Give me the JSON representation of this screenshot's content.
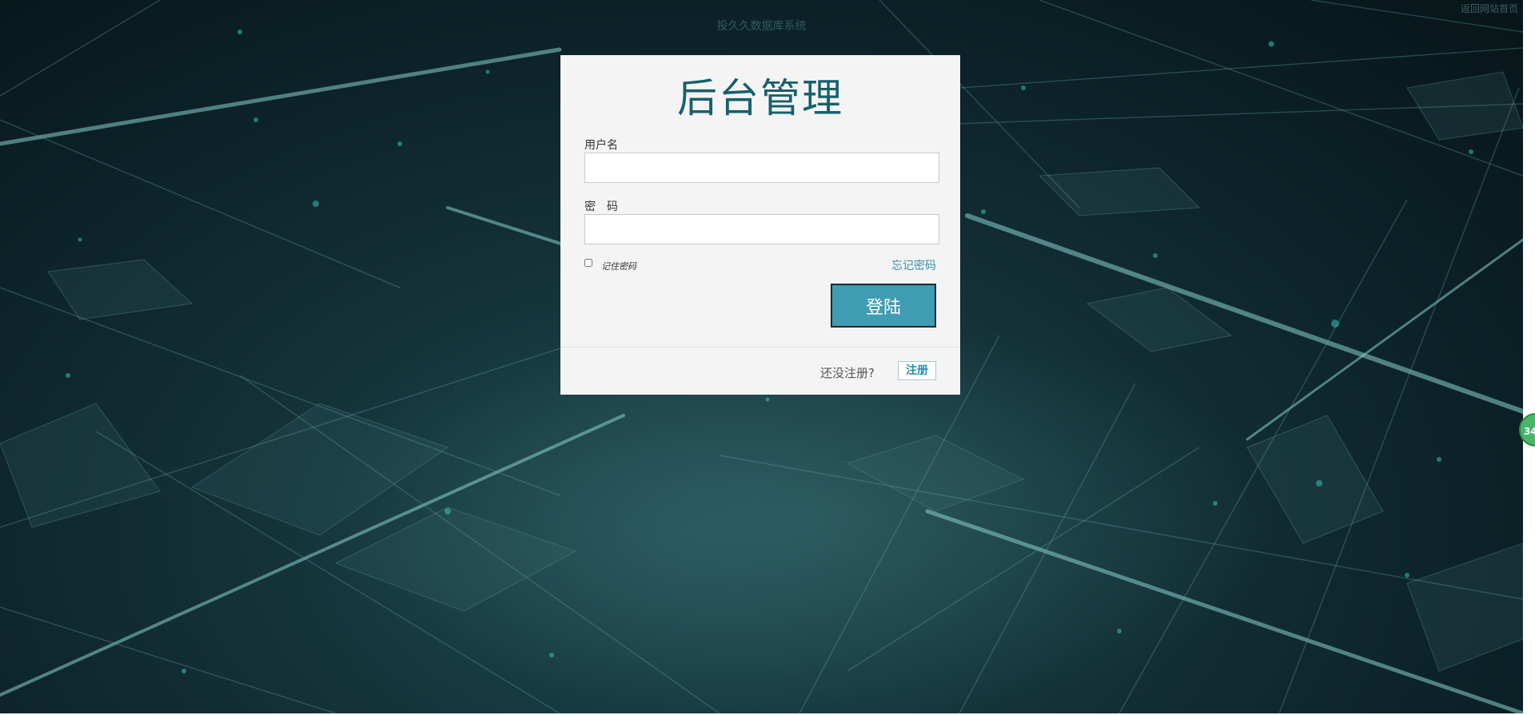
{
  "header": {
    "site_title": "投久久数据库系统",
    "back_home_link": "返回网站首页"
  },
  "login": {
    "title": "后台管理",
    "username_label": "用户名",
    "username_value": "",
    "password_label": "密　码",
    "password_value": "",
    "remember_label": "记住密码",
    "remember_checked": false,
    "forgot_link": "忘记密码",
    "submit_label": "登陆",
    "not_registered_text": "还没注册?",
    "register_label": "注册"
  },
  "float_widget": {
    "badge_text": "34"
  },
  "colors": {
    "accent": "#3f9cb3",
    "title": "#17606d",
    "link": "#3a8fa8",
    "background_dark": "#0c2329",
    "badge": "#4ab56b"
  }
}
